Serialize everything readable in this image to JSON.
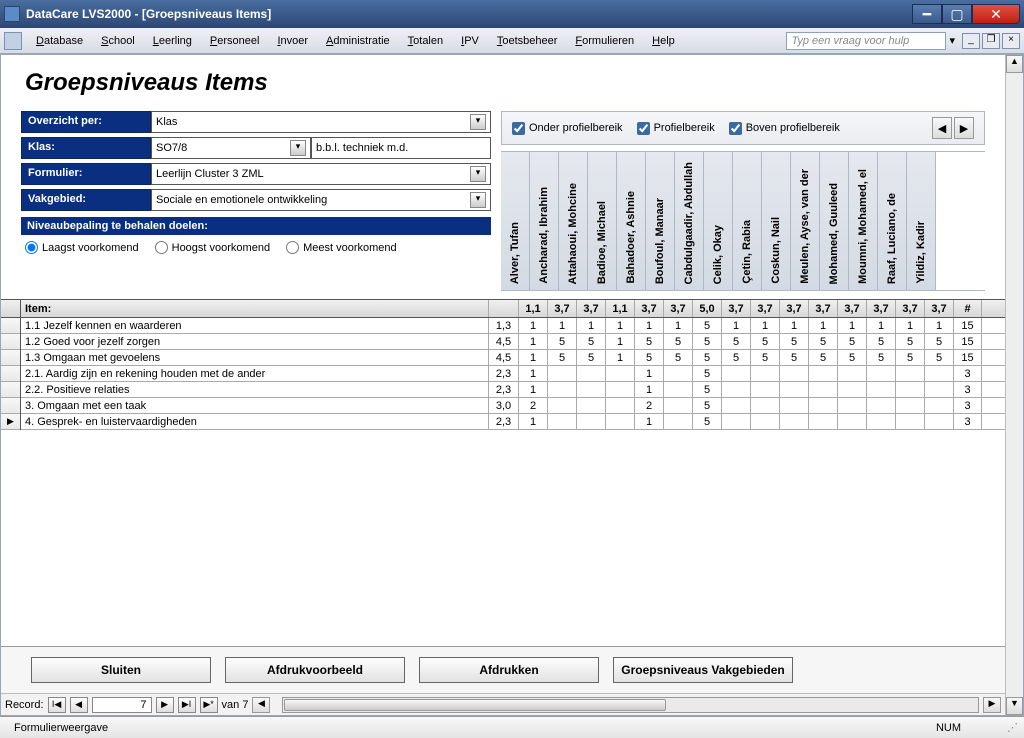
{
  "window": {
    "title": "DataCare LVS2000 - [Groepsniveaus Items]"
  },
  "menu": {
    "items": [
      "Database",
      "School",
      "Leerling",
      "Personeel",
      "Invoer",
      "Administratie",
      "Totalen",
      "IPV",
      "Toetsbeheer",
      "Formulieren",
      "Help"
    ],
    "help_placeholder": "Typ een vraag voor hulp"
  },
  "page": {
    "title": "Groepsniveaus Items"
  },
  "filters": {
    "overzicht_label": "Overzicht per:",
    "overzicht_value": "Klas",
    "klas_label": "Klas:",
    "klas_value": "SO7/8",
    "klas_extra": "b.b.l. techniek m.d.",
    "formulier_label": "Formulier:",
    "formulier_value": "Leerlijn Cluster 3 ZML",
    "vakgebied_label": "Vakgebied:",
    "vakgebied_value": "Sociale en emotionele ontwikkeling"
  },
  "niveaubepaling": {
    "header": "Niveaubepaling te behalen doelen:",
    "opts": [
      "Laagst voorkomend",
      "Hoogst voorkomend",
      "Meest voorkomend"
    ],
    "selected": 0
  },
  "checks": {
    "onder": "Onder profielbereik",
    "profiel": "Profielbereik",
    "boven": "Boven profielbereik"
  },
  "students": [
    "Alver, Tufan",
    "Ancharad, Ibrahim",
    "Attahaoui, Mohcine",
    "Badioe, Michael",
    "Bahadoer, Ashnie",
    "Boufoul, Manaar",
    "Cabdulgaadir, Abdullah",
    "Celik, Okay",
    "Çetin, Rabia",
    "Coskun, Nail",
    "Meulen, Ayse, van der",
    "Mohamed, Guuleed",
    "Moumni, Mohamed, el",
    "Raaf, Luciano, de",
    "Yildiz, Kadir"
  ],
  "grid": {
    "header_item": "Item:",
    "header_agg": "",
    "student_headvals": [
      "1,1",
      "3,7",
      "3,7",
      "1,1",
      "3,7",
      "3,7",
      "5,0",
      "3,7",
      "3,7",
      "3,7",
      "3,7",
      "3,7",
      "3,7",
      "3,7",
      "3,7"
    ],
    "count_head": "#",
    "rows": [
      {
        "item": "1.1 Jezelf kennen en waarderen",
        "agg": "1,3",
        "vals": [
          "1",
          "1",
          "1",
          "1",
          "1",
          "1",
          "5",
          "1",
          "1",
          "1",
          "1",
          "1",
          "1",
          "1",
          "1"
        ],
        "cnt": "15"
      },
      {
        "item": "1.2 Goed voor jezelf zorgen",
        "agg": "4,5",
        "vals": [
          "1",
          "5",
          "5",
          "1",
          "5",
          "5",
          "5",
          "5",
          "5",
          "5",
          "5",
          "5",
          "5",
          "5",
          "5"
        ],
        "cnt": "15"
      },
      {
        "item": "1.3 Omgaan met gevoelens",
        "agg": "4,5",
        "vals": [
          "1",
          "5",
          "5",
          "1",
          "5",
          "5",
          "5",
          "5",
          "5",
          "5",
          "5",
          "5",
          "5",
          "5",
          "5"
        ],
        "cnt": "15"
      },
      {
        "item": "2.1. Aardig zijn en rekening houden met de ander",
        "agg": "2,3",
        "vals": [
          "1",
          "",
          "",
          "",
          "1",
          "",
          "5",
          "",
          "",
          "",
          "",
          "",
          "",
          "",
          ""
        ],
        "cnt": "3"
      },
      {
        "item": "2.2. Positieve relaties",
        "agg": "2,3",
        "vals": [
          "1",
          "",
          "",
          "",
          "1",
          "",
          "5",
          "",
          "",
          "",
          "",
          "",
          "",
          "",
          ""
        ],
        "cnt": "3"
      },
      {
        "item": "3. Omgaan met een taak",
        "agg": "3,0",
        "vals": [
          "2",
          "",
          "",
          "",
          "2",
          "",
          "5",
          "",
          "",
          "",
          "",
          "",
          "",
          "",
          ""
        ],
        "cnt": "3"
      },
      {
        "item": "4. Gesprek- en luistervaardigheden",
        "agg": "2,3",
        "vals": [
          "1",
          "",
          "",
          "",
          "1",
          "",
          "5",
          "",
          "",
          "",
          "",
          "",
          "",
          "",
          ""
        ],
        "cnt": "3"
      }
    ]
  },
  "buttons": {
    "sluiten": "Sluiten",
    "afdrukvoorbeeld": "Afdrukvoorbeeld",
    "afdrukken": "Afdrukken",
    "vakgebieden": "Groepsniveaus Vakgebieden"
  },
  "recordnav": {
    "label": "Record:",
    "value": "7",
    "of_label": "van  7"
  },
  "status": {
    "mode": "Formulierweergave",
    "num": "NUM"
  }
}
